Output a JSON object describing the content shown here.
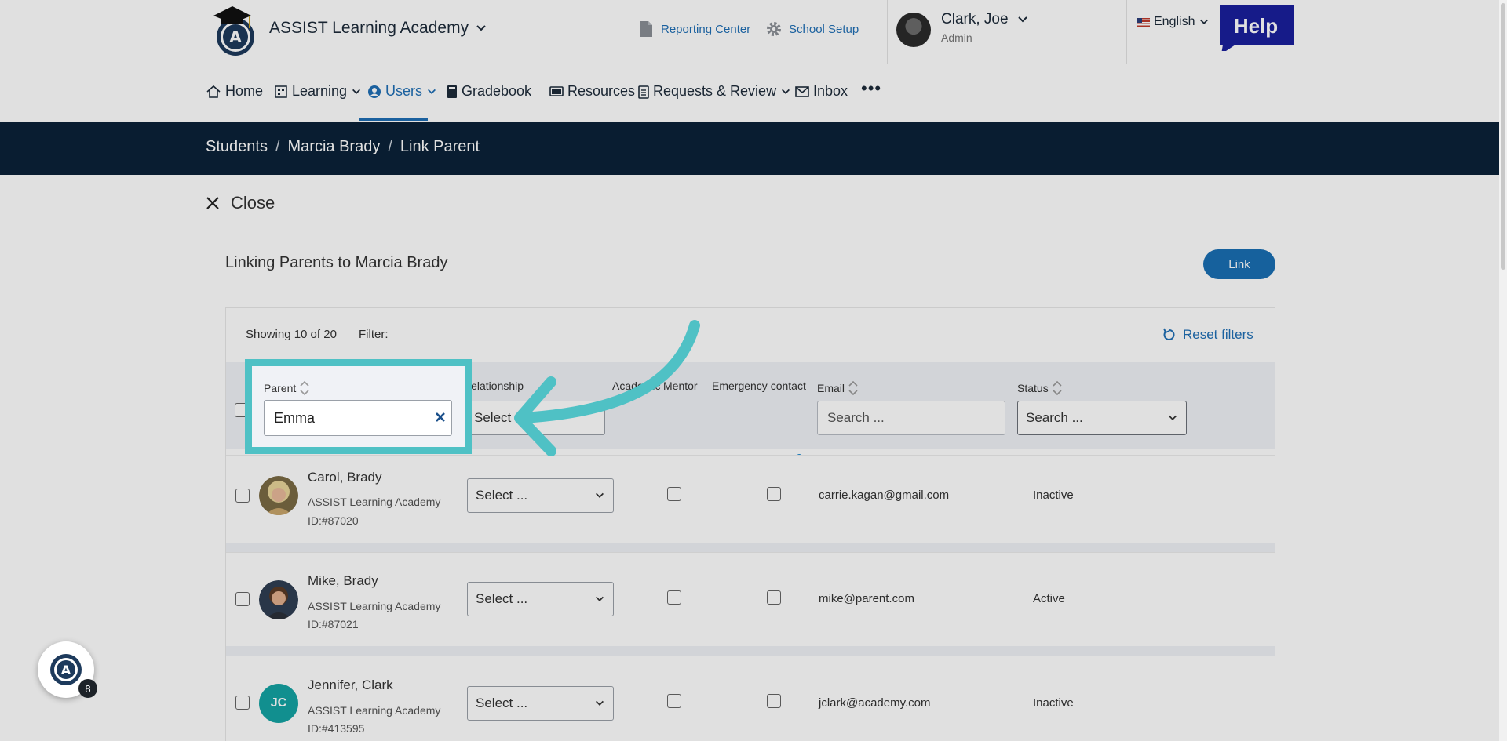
{
  "header": {
    "org_name": "ASSIST Learning Academy",
    "reporting_center": "Reporting Center",
    "school_setup": "School Setup",
    "user_name": "Clark, Joe",
    "user_role": "Admin",
    "language": "English",
    "help_label": "Help"
  },
  "nav": {
    "home": "Home",
    "learning": "Learning",
    "users": "Users",
    "gradebook": "Gradebook",
    "resources": "Resources",
    "requests": "Requests & Review",
    "inbox": "Inbox",
    "more": "•••"
  },
  "breadcrumb": {
    "students": "Students",
    "student": "Marcia Brady",
    "current": "Link Parent",
    "sep": "/"
  },
  "page": {
    "close": "Close",
    "heading": "Linking Parents to Marcia Brady",
    "link_button": "Link",
    "showing": "Showing 10 of 20",
    "filter": "Filter:",
    "reset": "Reset filters"
  },
  "columns": {
    "parent": "Parent",
    "relationship": "Relationship",
    "academic": "Academic",
    "mentor": "Mentor",
    "emergency": "Emergency contact",
    "email": "Email",
    "status": "Status"
  },
  "filters": {
    "parent_value": "Emma",
    "relationship_value": "Select ...",
    "email_placeholder": "Search ...",
    "status_placeholder": "Search ..."
  },
  "rows": [
    {
      "name": "Carol, Brady",
      "org": "ASSIST Learning Academy",
      "id": "ID:#87020",
      "relationship": "Select ...",
      "email": "carrie.kagan@gmail.com",
      "status": "Inactive"
    },
    {
      "name": "Mike, Brady",
      "org": "ASSIST Learning Academy",
      "id": "ID:#87021",
      "relationship": "Select ...",
      "email": "mike@parent.com",
      "status": "Active"
    },
    {
      "name": "Jennifer, Clark",
      "org": "ASSIST Learning Academy",
      "id": "ID:#413595",
      "relationship": "Select ...",
      "email": "jclark@academy.com",
      "status": "Inactive",
      "initials": "JC"
    }
  ],
  "fab": {
    "badge": "8"
  },
  "colors": {
    "primary": "#1a6fb3",
    "band": "#0b2238",
    "highlight": "#4fc1c5",
    "initials_bg": "#14a3a3"
  }
}
